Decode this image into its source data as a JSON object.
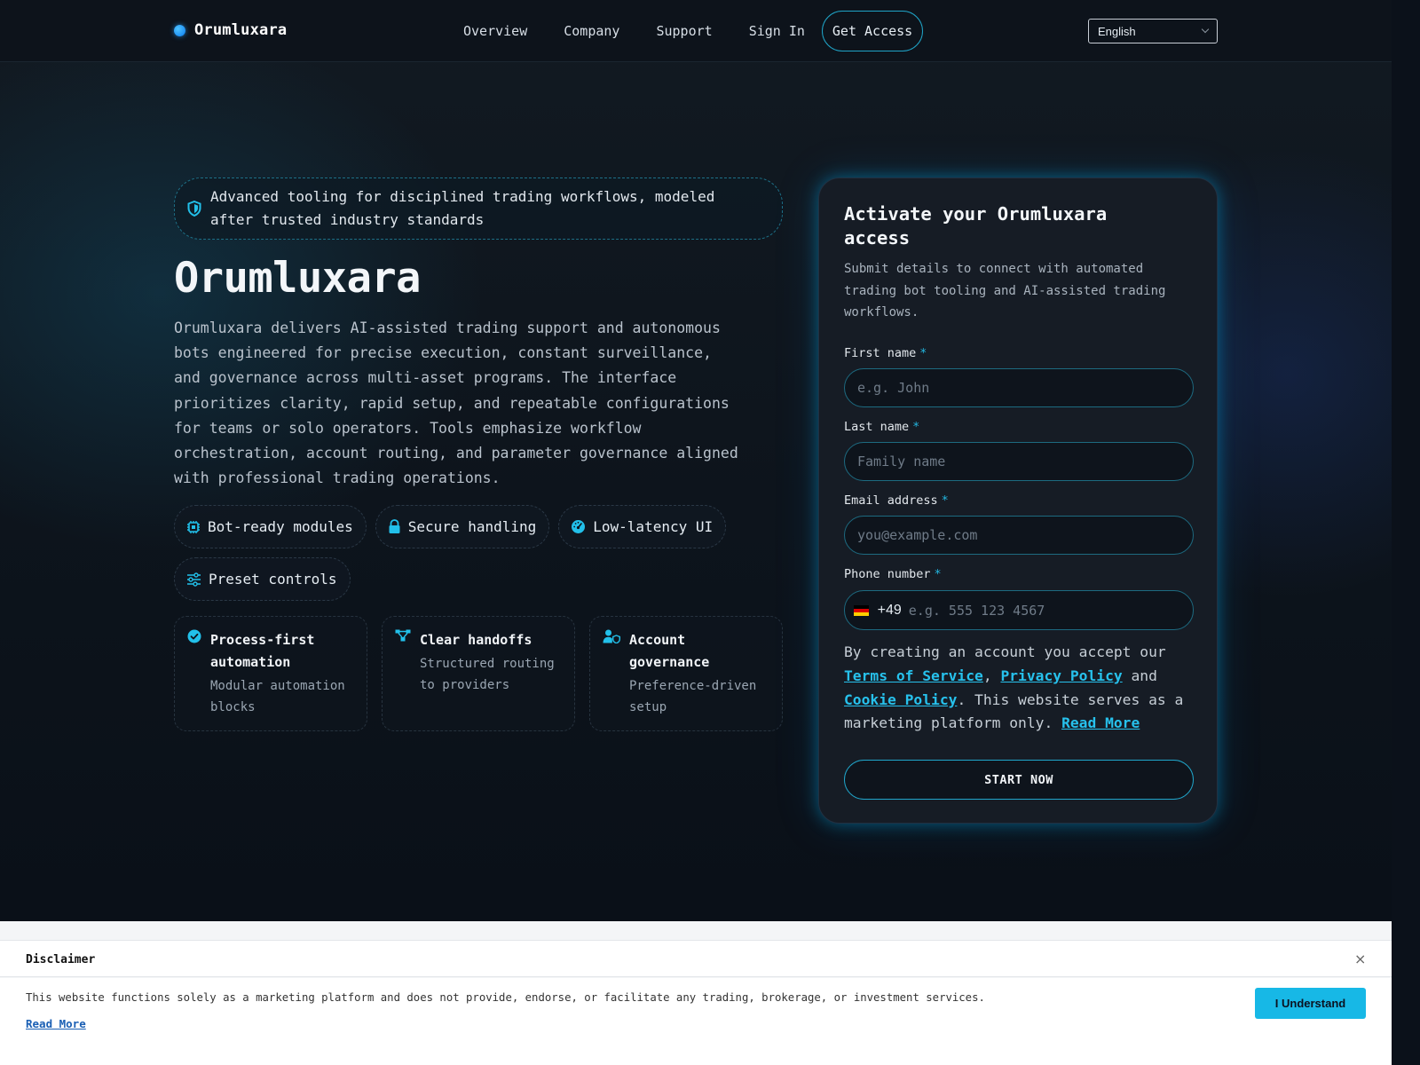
{
  "nav": {
    "brand": "Orumluxara",
    "links": [
      "Overview",
      "Company",
      "Support",
      "Sign In"
    ],
    "cta": "Get Access",
    "language": "English"
  },
  "hero": {
    "badge": "Advanced tooling for disciplined trading workflows, modeled after trusted industry standards",
    "title": "Orumluxara",
    "description": "Orumluxara delivers AI-assisted trading support and autonomous bots engineered for precise execution, constant surveillance, and governance across multi-asset programs. The interface prioritizes clarity, rapid setup, and repeatable configurations for teams or solo operators. Tools emphasize workflow orchestration, account routing, and parameter governance aligned with professional trading operations.",
    "chips": [
      {
        "label": "Bot-ready modules",
        "icon": "chip-icon"
      },
      {
        "label": "Secure handling",
        "icon": "lock-icon"
      },
      {
        "label": "Low-latency UI",
        "icon": "gauge-icon"
      },
      {
        "label": "Preset controls",
        "icon": "sliders-icon"
      }
    ],
    "features": [
      {
        "title": "Process-first automation",
        "sub": "Modular automation blocks",
        "icon": "check-circle-icon"
      },
      {
        "title": "Clear handoffs",
        "sub": "Structured routing to providers",
        "icon": "network-icon"
      },
      {
        "title": "Account governance",
        "sub": "Preference-driven setup",
        "icon": "user-shield-icon"
      }
    ]
  },
  "form": {
    "title": "Activate your Orumluxara access",
    "subtitle": "Submit details to connect with automated trading bot tooling and AI-assisted trading workflows.",
    "required_mark": "*",
    "first_name": {
      "label": "First name",
      "placeholder": "e.g. John"
    },
    "last_name": {
      "label": "Last name",
      "placeholder": "Family name"
    },
    "email": {
      "label": "Email address",
      "placeholder": "you@example.com"
    },
    "phone": {
      "label": "Phone number",
      "code": "+49",
      "placeholder": "e.g. 555 123 4567"
    },
    "consent": {
      "prefix": "By creating an account you accept our ",
      "terms": "Terms of Service",
      "comma": ", ",
      "privacy": "Privacy Policy",
      "and": " and ",
      "cookie": "Cookie Policy",
      "suffix": ". This website serves as a marketing platform only. ",
      "read_more": "Read More"
    },
    "submit": "START NOW"
  },
  "disclaimer": {
    "title": "Disclaimer",
    "close": "×",
    "text": "This website functions solely as a marketing platform and does not provide, endorse, or facilitate any trading, brokerage, or investment services.",
    "read_more": "Read More",
    "button": "I Understand"
  },
  "colors": {
    "accent": "#1fb8e6",
    "background": "#0b111a",
    "card": "#161c25"
  }
}
